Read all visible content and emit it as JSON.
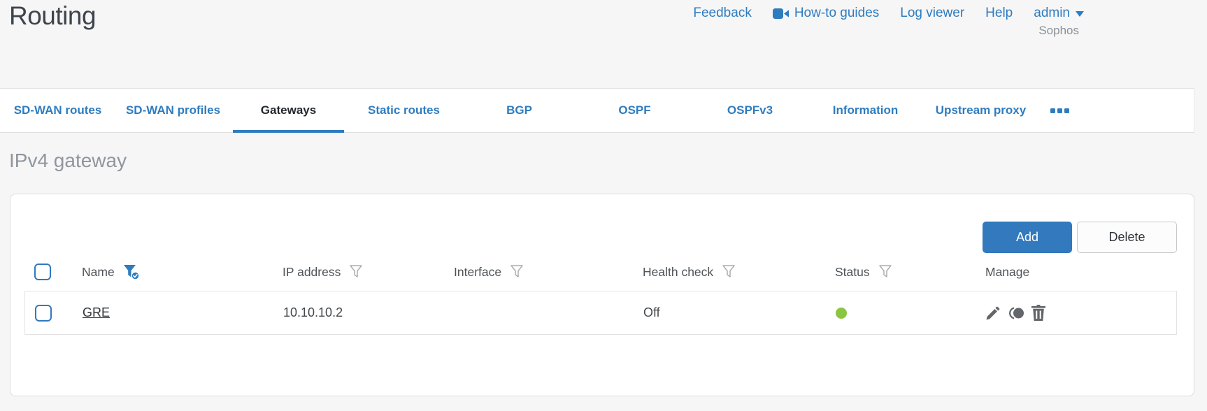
{
  "page": {
    "title": "Routing"
  },
  "header": {
    "links": [
      {
        "label": "Feedback"
      },
      {
        "label": "How-to guides",
        "icon": "video-camera-icon"
      },
      {
        "label": "Log viewer"
      },
      {
        "label": "Help"
      }
    ],
    "user": {
      "name": "admin"
    },
    "brand": "Sophos"
  },
  "tabs": [
    {
      "label": "SD-WAN routes"
    },
    {
      "label": "SD-WAN profiles"
    },
    {
      "label": "Gateways",
      "active": true
    },
    {
      "label": "Static routes"
    },
    {
      "label": "BGP"
    },
    {
      "label": "OSPF"
    },
    {
      "label": "OSPFv3"
    },
    {
      "label": "Information"
    },
    {
      "label": "Upstream proxy"
    }
  ],
  "section": {
    "heading": "IPv4 gateway"
  },
  "toolbar": {
    "add_label": "Add",
    "delete_label": "Delete"
  },
  "table": {
    "columns": [
      {
        "label": "Name",
        "filter": "active"
      },
      {
        "label": "IP address",
        "filter": "inactive"
      },
      {
        "label": "Interface",
        "filter": "inactive"
      },
      {
        "label": "Health check",
        "filter": "inactive"
      },
      {
        "label": "Status",
        "filter": "inactive"
      },
      {
        "label": "Manage",
        "filter": "none"
      }
    ],
    "rows": [
      {
        "name": "GRE",
        "ip_address": "10.10.10.2",
        "interface": "",
        "health_check": "Off",
        "status": "green",
        "manage_icons": [
          "edit",
          "clone",
          "delete"
        ]
      }
    ]
  },
  "colors": {
    "accent_blue": "#2e7cbf",
    "status_green": "#8bc541"
  }
}
